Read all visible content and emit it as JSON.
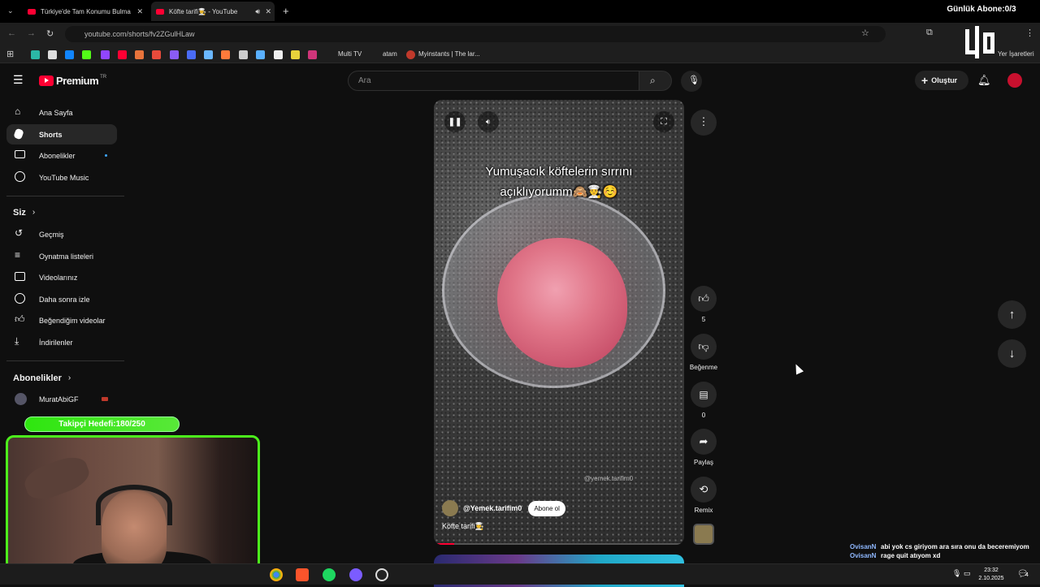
{
  "browser": {
    "tabs": [
      {
        "title": "Türkiye'de Tam Konumu Bulma",
        "active": false
      },
      {
        "title": "Köfte tarifi👨‍🍳 - YouTube",
        "active": true
      }
    ],
    "url": "youtube.com/shorts/fv2ZGulHLaw",
    "bookmarks": [
      "Multi TV",
      "atam",
      "Myinstants | The lar...",
      "Yer İşaretleri"
    ]
  },
  "youtube": {
    "brand": "Premium",
    "brand_region": "TR",
    "search_placeholder": "Ara",
    "create_label": "Oluştur",
    "sidebar": {
      "main": [
        "Ana Sayfa",
        "Shorts",
        "Abonelikler",
        "YouTube Music"
      ],
      "you_header": "Siz",
      "you": [
        "Geçmiş",
        "Oynatma listeleri",
        "Videolarınız",
        "Daha sonra izle",
        "Beğendiğim videolar",
        "İndirilenler"
      ],
      "subs_header": "Abonelikler",
      "subs": [
        "MuratAbiGF"
      ]
    },
    "short": {
      "overlay_line1": "Yumuşacık köftelerin sırrını",
      "overlay_line2": "açıklıyorumm🙈👨‍🍳☺️",
      "watermark": "@yemek.tarifim0",
      "channel": "@Yemek.tarifim0",
      "subscribe": "Abone ol",
      "caption": "Köfte tarifi👨‍🍳",
      "progress": 0.08
    },
    "actions": {
      "likes": "5",
      "dislike_label": "Beğenme",
      "comments": "0",
      "share_label": "Paylaş",
      "remix_label": "Remix"
    }
  },
  "stream_overlay": {
    "sub_goal": "Günlük Abone:0/3",
    "follower_goal": "Takipçi Hedefi:180/250",
    "chat": [
      {
        "user": "OvisanN",
        "message": "abi yok cs giriyom ara sıra onu da beceremiyom"
      },
      {
        "user": "OvisanN",
        "message": "rage quit atıyom xd"
      }
    ]
  },
  "taskbar": {
    "time": "23:32",
    "date": "2.10.2025",
    "notifications": "4"
  },
  "colors": {
    "accent": "#ff0033",
    "goal_green": "#4cf01c",
    "background": "#0f0f0f"
  }
}
